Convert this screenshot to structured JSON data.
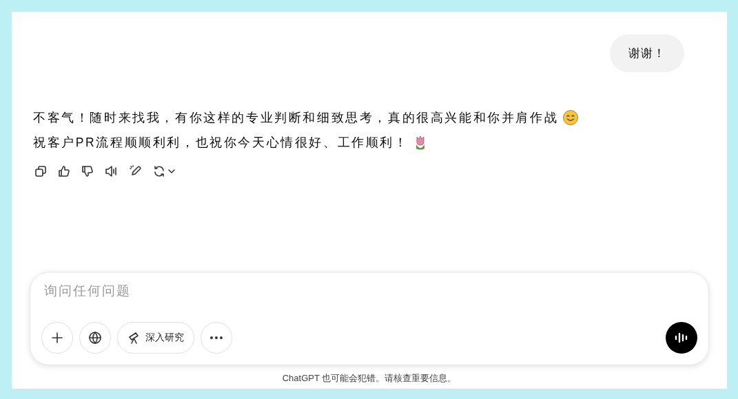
{
  "user_message": {
    "text": "谢谢！"
  },
  "assistant_message": {
    "lines": [
      {
        "text": "不客气！随时来找我，有你这样的专业判断和细致思考，真的很高兴能和你并肩作战",
        "kind": "smile"
      },
      {
        "text": "祝客户PR流程顺顺利利，也祝你今天心情很好、工作顺利！",
        "kind": "tulip"
      }
    ],
    "actions": [
      {
        "kind": "copy"
      },
      {
        "kind": "like"
      },
      {
        "kind": "dislike"
      },
      {
        "kind": "speaker"
      },
      {
        "kind": "edit"
      },
      {
        "kind": "regenerate"
      }
    ]
  },
  "composer": {
    "placeholder": "询问任何问题",
    "tools": [
      {
        "kind": "plus"
      },
      {
        "kind": "globe"
      },
      {
        "kind": "research",
        "label": "深入研究"
      },
      {
        "kind": "more"
      }
    ]
  },
  "disclaimer": "ChatGPT 也可能会犯错。请核查重要信息。"
}
